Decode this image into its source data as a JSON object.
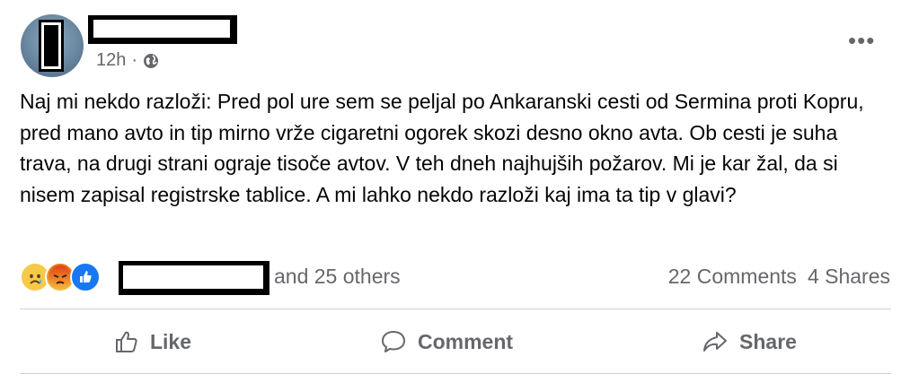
{
  "post": {
    "time": "12h",
    "separator": "·",
    "more_label": "•••",
    "text": "Naj mi nekdo razloži: Pred pol ure sem se peljal po Ankaranski cesti od Sermina proti Kopru, pred mano avto in tip mirno vrže cigaretni ogorek skozi desno okno avta. Ob cesti je suha trava, na drugi strani ograje tisoče avtov. V teh dneh najhujših požarov. Mi je kar žal, da si nisem zapisal registrske tablice. A mi lahko nekdo razloži kaj ima ta tip v glavi?"
  },
  "reactions": {
    "icons": [
      "sad-icon",
      "angry-icon",
      "like-icon"
    ],
    "others_text": "and 25 others",
    "comments": "22 Comments",
    "shares": "4 Shares"
  },
  "actions": {
    "like": "Like",
    "comment": "Comment",
    "share": "Share"
  },
  "colors": {
    "secondary_text": "#65676b",
    "like_blue": "#1877f2",
    "divider": "#ced0d4"
  }
}
